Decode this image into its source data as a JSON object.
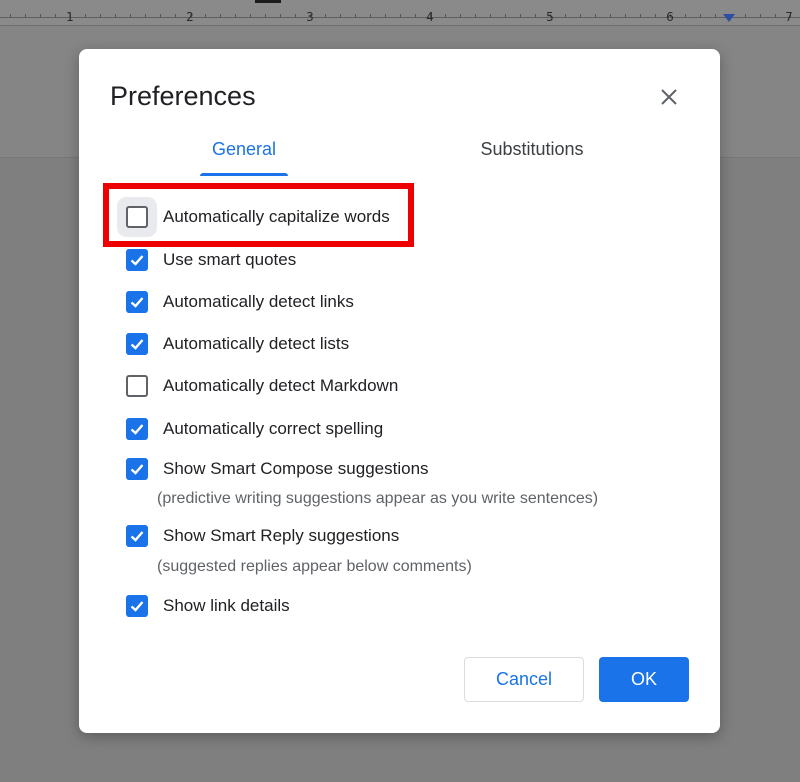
{
  "ruler": {
    "numbers": [
      "1",
      "2",
      "3",
      "4",
      "5",
      "6",
      "7"
    ]
  },
  "dialog": {
    "title": "Preferences",
    "close_icon": "close-icon"
  },
  "tabs": [
    {
      "label": "General",
      "active": true
    },
    {
      "label": "Substitutions",
      "active": false
    }
  ],
  "options": [
    {
      "label": "Automatically capitalize words",
      "checked": false,
      "focused": true,
      "highlighted": true
    },
    {
      "label": "Use smart quotes",
      "checked": true
    },
    {
      "label": "Automatically detect links",
      "checked": true
    },
    {
      "label": "Automatically detect lists",
      "checked": true
    },
    {
      "label": "Automatically detect Markdown",
      "checked": false
    },
    {
      "label": "Automatically correct spelling",
      "checked": true
    },
    {
      "label": "Show Smart Compose suggestions",
      "checked": true,
      "hint": "(predictive writing suggestions appear as you write sentences)"
    },
    {
      "label": "Show Smart Reply suggestions",
      "checked": true,
      "hint": "(suggested replies appear below comments)"
    },
    {
      "label": "Show link details",
      "checked": true
    }
  ],
  "buttons": {
    "cancel": "Cancel",
    "ok": "OK"
  },
  "colors": {
    "accent": "#1a73e8",
    "highlight": "#ef0000",
    "backdrop": "#7f7f7f"
  }
}
